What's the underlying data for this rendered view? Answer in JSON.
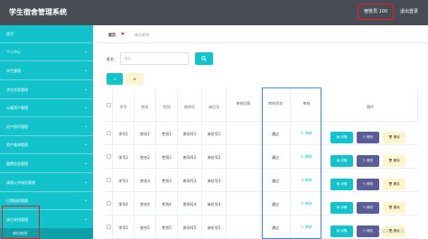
{
  "header": {
    "title": "学生宿舍管理系统",
    "user": "宿管员 100",
    "logout": "退出登录"
  },
  "sidebar": {
    "items": [
      {
        "label": "首页",
        "chevron": false
      },
      {
        "label": "个人中心",
        "chevron": true
      },
      {
        "label": "学生管理",
        "chevron": true
      },
      {
        "label": "学生信息管理",
        "chevron": true
      },
      {
        "label": "公寓资产管理",
        "chevron": true
      },
      {
        "label": "资产损坏管理",
        "chevron": true
      },
      {
        "label": "资产维修管理",
        "chevron": true
      },
      {
        "label": "缴费信息管理",
        "chevron": true
      },
      {
        "label": "清理公共场所管理",
        "chevron": true
      },
      {
        "label": "日常巡检管理",
        "chevron": true
      },
      {
        "label": "床位安排管理",
        "chevron": true
      }
    ],
    "sub_item": "床位安排"
  },
  "breadcrumb": {
    "home": "首页",
    "current": "床位安排"
  },
  "search": {
    "label": "姓名",
    "placeholder": "姓名"
  },
  "actions": {
    "add": "+",
    "delete": "⊘"
  },
  "table": {
    "headers": [
      "学号",
      "姓名",
      "性别",
      "房间号",
      "床位号",
      "审核回复",
      "审核状态",
      "审核",
      "操作"
    ],
    "rows": [
      {
        "id": "学号1",
        "name": "姓名1",
        "gender": "性别1",
        "room": "房间号1",
        "bed": "床位号1",
        "status": "通过",
        "audit": "审核"
      },
      {
        "id": "学号2",
        "name": "姓名2",
        "gender": "性别2",
        "room": "房间号2",
        "bed": "床位号2",
        "status": "通过",
        "audit": "审核"
      },
      {
        "id": "学号3",
        "name": "姓名3",
        "gender": "性别3",
        "room": "房间号3",
        "bed": "床位号3",
        "status": "通过",
        "audit": "审核"
      },
      {
        "id": "学号4",
        "name": "姓名4",
        "gender": "性别4",
        "room": "房间号4",
        "bed": "床位号4",
        "status": "通过",
        "audit": "审核"
      },
      {
        "id": "学号5",
        "name": "姓名5",
        "gender": "性别5",
        "room": "房间号5",
        "bed": "床位号5",
        "status": "通过",
        "audit": "审核"
      }
    ],
    "op_labels": {
      "detail": "详情",
      "edit": "修改",
      "delete": "删除"
    }
  },
  "watermark": "CSDN @什木耳",
  "colors": {
    "accent": "#12c3cc",
    "header": "#474c55",
    "highlight_red": "#e02020",
    "highlight_blue": "#3a8ee6",
    "edit": "#5a5d96",
    "warn": "#fdf6cd"
  }
}
